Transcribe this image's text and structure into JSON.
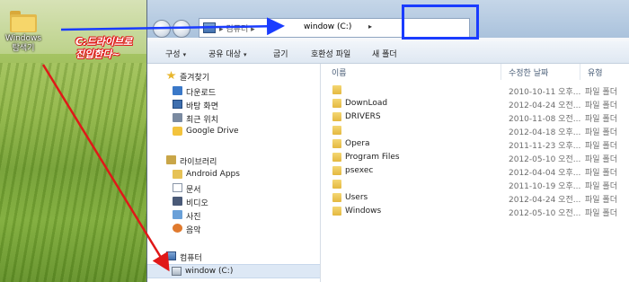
{
  "desktop": {
    "icon_label_line1": "Windows",
    "icon_label_line2": "탐색기",
    "annotation_line1": "C:드라이브로",
    "annotation_line2": "진입한다~"
  },
  "address_bar": {
    "crumb_parent": "▸ 컴퓨터 ▸",
    "current": "window (C:)",
    "arrow": "▸"
  },
  "toolbar": {
    "organize": "구성",
    "share": "공유 대상",
    "burn": "굽기",
    "compat": "호환성 파일",
    "new_folder": "새 폴더"
  },
  "nav": {
    "favorites": "즐겨찾기",
    "downloads": "다운로드",
    "desktop": "바탕 화면",
    "recent": "최근 위치",
    "gdrive": "Google Drive",
    "libraries": "라이브러리",
    "android": "Android Apps",
    "documents": "문서",
    "videos": "비디오",
    "pictures": "사진",
    "music": "음악",
    "computer": "컴퓨터",
    "drive_c": "window (C:)"
  },
  "columns": {
    "name": "이름",
    "modified": "수정한 날짜",
    "type": "유형"
  },
  "files": [
    {
      "name": "",
      "date": "2010-10-11 오후...",
      "type": "파일 폴더"
    },
    {
      "name": "DownLoad",
      "date": "2012-04-24 오전...",
      "type": "파일 폴더"
    },
    {
      "name": "DRIVERS",
      "date": "2010-11-08 오전...",
      "type": "파일 폴더"
    },
    {
      "name": "",
      "date": "2012-04-18 오후...",
      "type": "파일 폴더"
    },
    {
      "name": "Opera",
      "date": "2011-11-23 오후...",
      "type": "파일 폴더"
    },
    {
      "name": "Program Files",
      "date": "2012-05-10 오전...",
      "type": "파일 폴더"
    },
    {
      "name": "psexec",
      "date": "2012-04-04 오후...",
      "type": "파일 폴더"
    },
    {
      "name": "",
      "date": "2011-10-19 오후...",
      "type": "파일 폴더"
    },
    {
      "name": "Users",
      "date": "2012-04-24 오전...",
      "type": "파일 폴더"
    },
    {
      "name": "Windows",
      "date": "2012-05-10 오전...",
      "type": "파일 폴더"
    }
  ],
  "colors": {
    "highlight_box": "#1a3cff",
    "arrow_red": "#e01818",
    "arrow_blue": "#1a3cff"
  }
}
